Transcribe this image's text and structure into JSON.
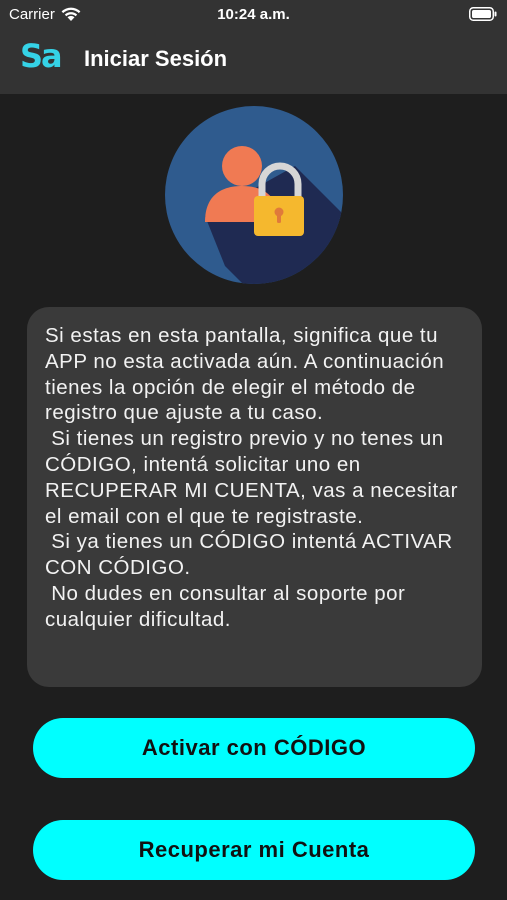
{
  "status_bar": {
    "carrier": "Carrier",
    "time": "10:24 a.m.",
    "wifi_icon": "wifi-icon",
    "battery_icon": "battery-icon"
  },
  "nav": {
    "logo_text": "Sa",
    "title": "Iniciar Sesión"
  },
  "hero": {
    "icon": "user-lock-icon"
  },
  "info": {
    "text": "Si estas en esta pantalla, significa que tu APP no esta activada aún. A continuación tienes la opción de elegir el método de registro que ajuste a tu caso.\n Si tienes un registro previo y no tenes un CÓDIGO, intentá solicitar uno en RECUPERAR MI CUENTA, vas a necesitar el email con el que te registraste.\n Si ya tienes un CÓDIGO intentá ACTIVAR CON CÓDIGO.\n No dudes en consultar al soporte por cualquier dificultad."
  },
  "buttons": {
    "activate": "Activar con CÓDIGO",
    "recover": "Recuperar mi Cuenta"
  },
  "colors": {
    "accent": "#00ffff",
    "bar": "#333333",
    "background": "#1e1e1e",
    "card": "#3a3a3a"
  }
}
